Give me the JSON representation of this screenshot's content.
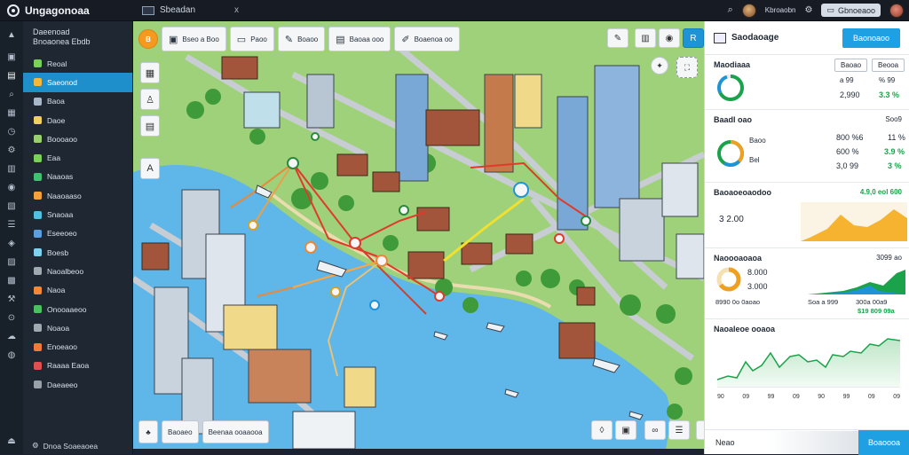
{
  "app": {
    "title": "Ungagonoaa"
  },
  "topbar": {
    "tab_label": "Sbeadan",
    "close_label": "x",
    "user_name": "Kbroaobn",
    "profile_label": "Gbnoeaoo"
  },
  "sidebar": {
    "heading_1": "Daeenoad",
    "heading_2": "Bnoaonea Ebdb",
    "items": [
      {
        "label": "Reoal",
        "color": "#7ad15a"
      },
      {
        "label": "Saeonod",
        "color": "#f5b83a",
        "active": true
      },
      {
        "label": "Baoa",
        "color": "#a8b8c8"
      },
      {
        "label": "Daoe",
        "color": "#f0d060"
      },
      {
        "label": "Boooaoo",
        "color": "#9ad070"
      },
      {
        "label": "Eaa",
        "color": "#7ad15a"
      },
      {
        "label": "Naaoas",
        "color": "#40c070"
      },
      {
        "label": "Naaoaaso",
        "color": "#f5a13a"
      },
      {
        "label": "Snaoaa",
        "color": "#50c0e0"
      },
      {
        "label": "Eseeoeo",
        "color": "#5aa0e0"
      },
      {
        "label": "Boesb",
        "color": "#80d0f0"
      },
      {
        "label": "Naoalbeoo",
        "color": "#a0a8b0"
      },
      {
        "label": "Naoa",
        "color": "#f08a3a"
      },
      {
        "label": "Onooaaeoo",
        "color": "#4ac060"
      },
      {
        "label": "Noaoa",
        "color": "#a0a8b0"
      },
      {
        "label": "Enoeaoo",
        "color": "#f07a3a"
      },
      {
        "label": "Raaaa Eaoa",
        "color": "#e05050"
      },
      {
        "label": "Daeaeeo",
        "color": "#9aa0a8"
      }
    ],
    "footer_label": "Dnoa Soaeaoea"
  },
  "toolbar": {
    "items": [
      "Bseo a Boo",
      "Paoo",
      "Boaoo",
      "Baoaa ooo",
      "Boaenoa oo"
    ]
  },
  "map_bottom": {
    "items": [
      "Baoaeo",
      "Beenaa ooaaooa"
    ]
  },
  "panel": {
    "title": "Saodaoage",
    "header_button": "Baonoaoo",
    "overview": {
      "title": "Maodiaaa",
      "buttons": [
        "Baoao",
        "Beooa"
      ],
      "val_a": "2,990",
      "val_b": "3.3 %",
      "top_a": "a 99",
      "top_b": "% 99"
    },
    "breakdown": {
      "title": "Baadl oao",
      "corner": "Soo9",
      "label_1": "Baoo",
      "label_2": "Bel",
      "val_1": "800 %6",
      "val_2": "600 %",
      "val_3": "3,0 99",
      "pct_1": "11 %",
      "pct_2": "3.9 %",
      "pct_3": "3 %"
    },
    "revenue": {
      "title": "Baoaoeoaodoo",
      "stat": "4.9,0 eol 600",
      "value": "3 2.00"
    },
    "forecast": {
      "title": "Naoooaoaoa",
      "corner": "3099 ao",
      "v1": "8.000",
      "v2": "3.000",
      "line1": "8990 0o 0aoao",
      "line2": "Soa a 999",
      "line3": "300a 00a9",
      "line4": "$19 809 09a"
    },
    "trend": {
      "title": "Naoaleoe ooaoa",
      "axis": [
        "90",
        "09",
        "99",
        "09",
        "90",
        "99",
        "09",
        "09"
      ]
    },
    "footer_label": "Neao",
    "footer_button": "Boaoooa"
  },
  "colors": {
    "accent": "#1ea0e3",
    "sidebar_active": "#1f8fcc",
    "positive": "#1aa34a",
    "water": "#5fb6e8",
    "grass": "#9fd07a"
  }
}
